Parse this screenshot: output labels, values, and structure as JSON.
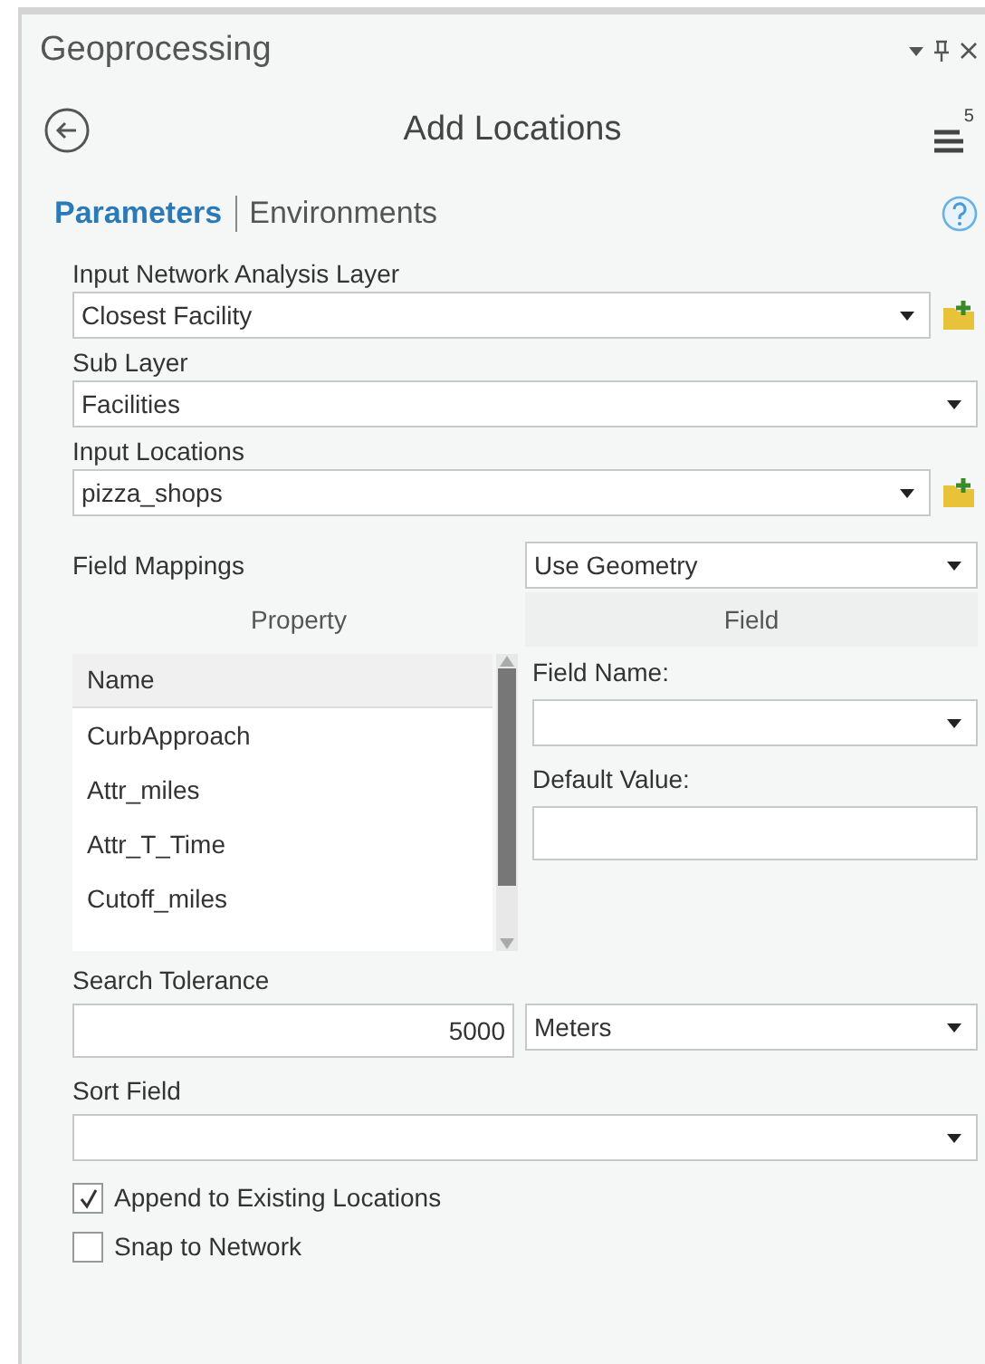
{
  "pane": {
    "title": "Geoprocessing",
    "tool_title": "Add Locations",
    "badge": "5"
  },
  "tabs": [
    {
      "label": "Parameters",
      "selected": true
    },
    {
      "label": "Environments",
      "selected": false
    }
  ],
  "parameters": [
    {
      "label": "Input Network Analysis Layer",
      "value": "Closest Facility",
      "add_button": true
    },
    {
      "label": "Sub Layer",
      "value": "Facilities",
      "add_button": false
    },
    {
      "label": "Input Locations",
      "value": "pizza_shops",
      "add_button": true
    }
  ],
  "field_mappings": {
    "label": "Field Mappings",
    "value": "Use Geometry",
    "columns": [
      "Property",
      "Field"
    ],
    "list_header": "Name",
    "rows": [
      {
        "name": "CurbApproach",
        "selected": false
      },
      {
        "name": "Attr_miles",
        "selected": false
      },
      {
        "name": "Attr_T_Time",
        "selected": false
      },
      {
        "name": "Cutoff_miles",
        "selected": false
      }
    ],
    "field_name_label": "Field Name:",
    "default_value_label": "Default Value:"
  },
  "search_tolerance": {
    "label": "Search Tolerance",
    "value": "5000",
    "unit": "Meters"
  },
  "sort_field": {
    "label": "Sort Field"
  },
  "options": [
    {
      "label": "Append to Existing Locations",
      "checked": true
    },
    {
      "label": "Snap to Network",
      "checked": false
    }
  ]
}
